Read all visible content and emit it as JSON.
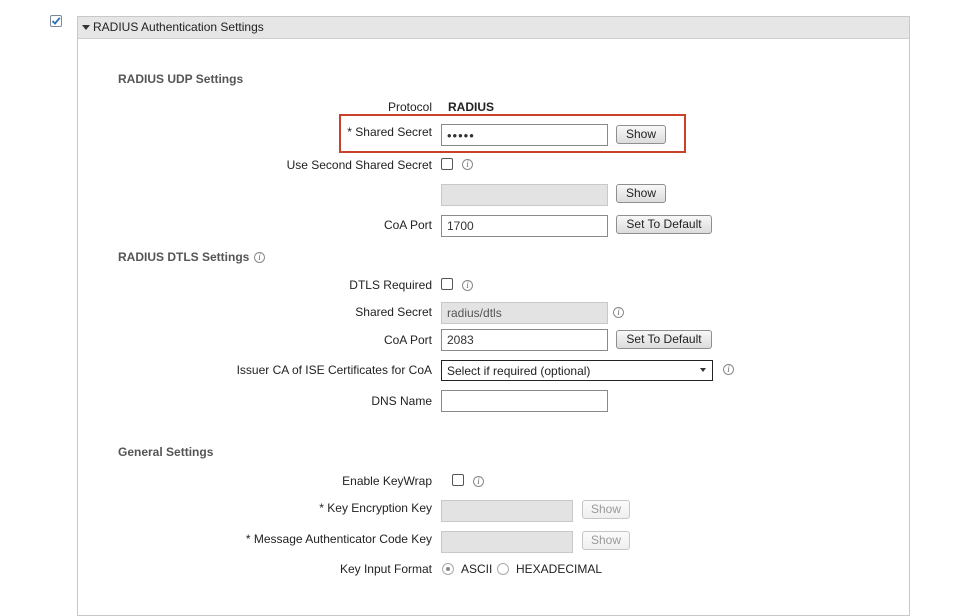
{
  "header": {
    "title": "RADIUS Authentication Settings"
  },
  "udp": {
    "section_title": "RADIUS UDP Settings",
    "protocol_label": "Protocol",
    "protocol_value": "RADIUS",
    "shared_secret_label": "* Shared Secret",
    "shared_secret_value": "•••••",
    "show_label": "Show",
    "second_secret_label": "Use Second Shared Secret",
    "second_show_label": "Show",
    "coa_port_label": "CoA Port",
    "coa_port_value": "1700",
    "set_default_label": "Set To Default"
  },
  "dtls": {
    "section_title": "RADIUS DTLS Settings",
    "dtls_required_label": "DTLS Required",
    "shared_secret_label": "Shared Secret",
    "shared_secret_value": "radius/dtls",
    "coa_port_label": "CoA Port",
    "coa_port_value": "2083",
    "set_default_label": "Set To Default",
    "issuer_label": "Issuer CA of ISE Certificates for CoA",
    "issuer_selected": "Select if required (optional)",
    "dns_label": "DNS Name",
    "dns_value": ""
  },
  "general": {
    "section_title": "General Settings",
    "keywrap_label": "Enable KeyWrap",
    "kek_label": "*  Key Encryption Key",
    "kek_show": "Show",
    "mack_label": "*  Message Authenticator Code Key",
    "mack_show": "Show",
    "key_format_label": "Key Input Format",
    "ascii_label": "ASCII",
    "hex_label": "HEXADECIMAL"
  },
  "colors": {
    "highlight": "#c9412b",
    "check": "#2a6fb7"
  },
  "icons": [
    "checkmark-icon",
    "caret-down-icon",
    "info-icon",
    "select-arrow-icon"
  ]
}
